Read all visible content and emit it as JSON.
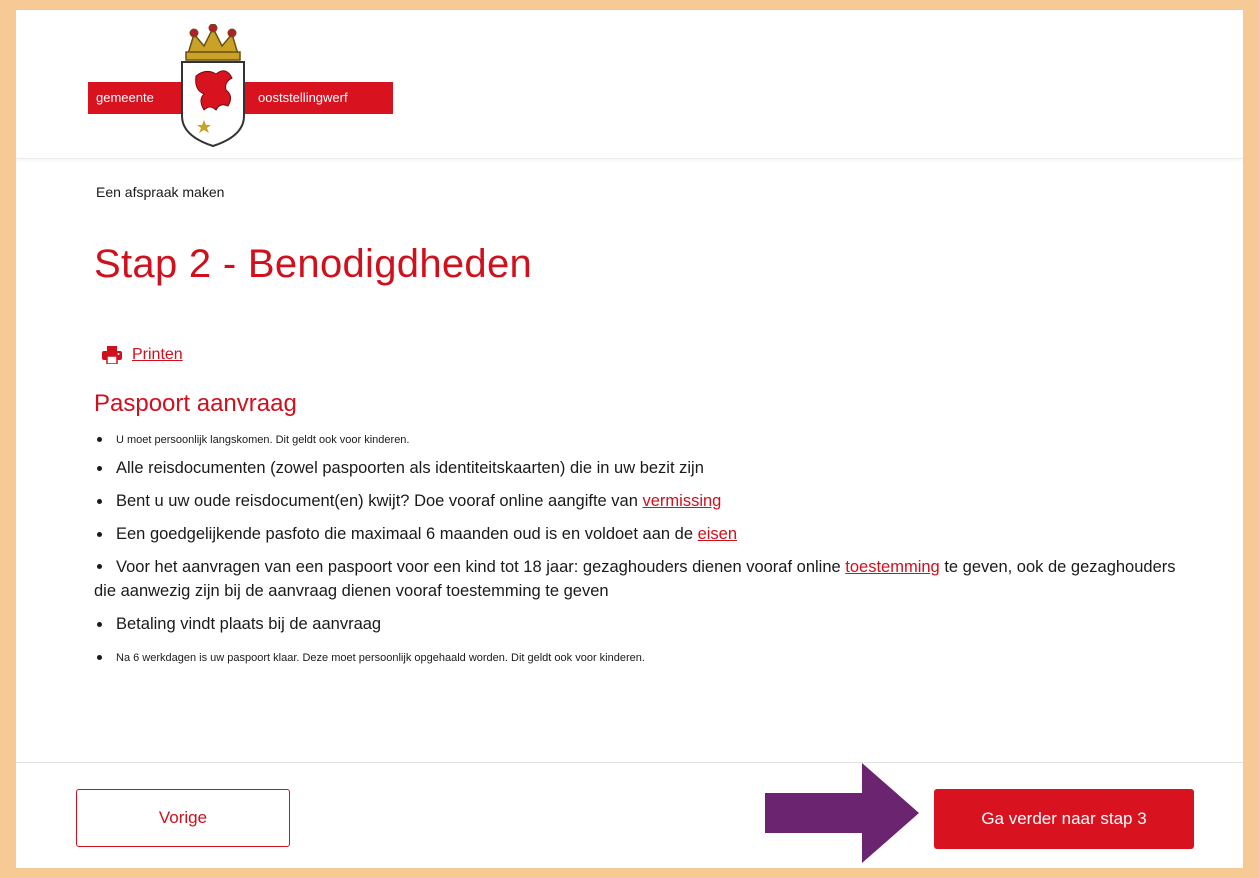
{
  "logo": {
    "text_left": "gemeente",
    "text_right": "ooststellingwerf",
    "icon": "coat-of-arms-icon"
  },
  "breadcrumb": "Een afspraak maken",
  "page_title": "Stap 2 - Benodigdheden",
  "print": {
    "label": "Printen",
    "icon": "printer-icon"
  },
  "section_title": "Paspoort aanvraag",
  "requirements": {
    "item1": "U moet persoonlijk langskomen. Dit geldt ook voor kinderen.",
    "item2": "Alle reisdocumenten (zowel paspoorten als identiteitskaarten) die in uw bezit zijn",
    "item3_text": "Bent u uw oude reisdocument(en) kwijt? Doe vooraf  online aangifte van ",
    "item3_link": "vermissing",
    "item4_text": "Een goedgelijkende pasfoto die maximaal 6 maanden oud is en voldoet aan de ",
    "item4_link": "eisen",
    "item5_text_a": "Voor het aanvragen van een paspoort voor een kind tot 18 jaar: gezaghouders dienen  vooraf online ",
    "item5_link": "toestemming",
    "item5_text_b": " te geven, ook de gezaghouders die aanwezig zijn bij de aanvraag dienen vooraf toestemming te geven",
    "item6": "Betaling vindt plaats bij de aanvraag",
    "item7": "Na 6 werkdagen is uw paspoort klaar. Deze moet persoonlijk opgehaald worden. Dit geldt ook voor kinderen."
  },
  "footer": {
    "prev_label": "Vorige",
    "next_label": "Ga verder naar stap 3"
  },
  "colors": {
    "accent": "#d0101d",
    "border_frame": "#f7c995",
    "arrow": "#6b2570"
  }
}
